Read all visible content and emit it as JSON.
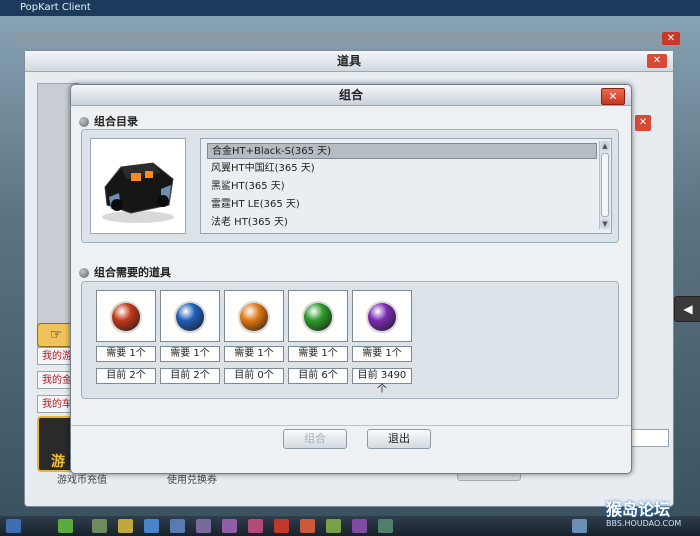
{
  "client": {
    "title": "PopKart Client"
  },
  "item_window": {
    "title": "道具",
    "close_label": "✕"
  },
  "background": {
    "side_links": [
      "我的游",
      "我的金",
      "我的车"
    ],
    "game_icon_label": "游",
    "text1": "游戏币充值",
    "text2": "使用兑换券"
  },
  "combo_dialog": {
    "title": "组合",
    "close_label": "✕",
    "catalog": {
      "header": "组合目录",
      "items": [
        {
          "label": "合金HT+Black-S(365 天)",
          "selected": true
        },
        {
          "label": "风翼HT中国红(365 天)",
          "selected": false
        },
        {
          "label": "黑鲨HT(365 天)",
          "selected": false
        },
        {
          "label": "雷霆HT LE(365 天)",
          "selected": false
        },
        {
          "label": "法老 HT(365 天)",
          "selected": false
        }
      ]
    },
    "requirements": {
      "header": "组合需要的道具",
      "items": [
        {
          "color": "#c0391a",
          "need": "需要 1个",
          "current": "目前 2个"
        },
        {
          "color": "#1f5fb8",
          "need": "需要 1个",
          "current": "目前 2个"
        },
        {
          "color": "#e07812",
          "need": "需要 1个",
          "current": "目前 0个"
        },
        {
          "color": "#2f9a2c",
          "need": "需要 1个",
          "current": "目前 6个"
        },
        {
          "color": "#7b2ab0",
          "need": "需要 1个",
          "current": "目前 3490个"
        }
      ]
    },
    "buttons": {
      "combine": "组合",
      "exit": "退出"
    }
  },
  "watermark": {
    "main": "猴岛论坛",
    "sub": "BBS.HOUDAO.COM"
  }
}
